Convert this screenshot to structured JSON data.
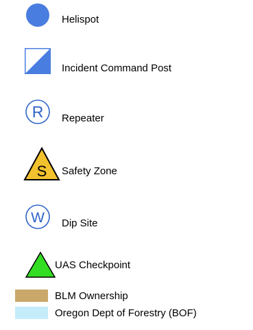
{
  "legend": {
    "items": [
      {
        "label": "Helispot",
        "icon": "helispot-circle-icon",
        "color": "#4a7de0"
      },
      {
        "label": "Incident Command Post",
        "icon": "command-post-square-icon",
        "color": "#4a7de0"
      },
      {
        "label": "Repeater",
        "icon": "repeater-r-circle-icon",
        "glyph": "R",
        "color": "#2f64c8"
      },
      {
        "label": "Safety Zone",
        "icon": "safety-zone-s-triangle-icon",
        "glyph": "S",
        "color": "#f2c12e"
      },
      {
        "label": "Dip Site",
        "icon": "dip-site-w-circle-icon",
        "glyph": "W",
        "color": "#2f64c8"
      },
      {
        "label": "UAS Checkpoint",
        "icon": "uas-checkpoint-triangle-icon",
        "color": "#33dd22"
      },
      {
        "label": "BLM Ownership",
        "icon": "blm-ownership-swatch-icon",
        "color": "#c9a86a"
      },
      {
        "label": "Oregon Dept of Forestry (BOF)",
        "icon": "odf-swatch-icon",
        "color": "#c4ecfb"
      }
    ]
  }
}
